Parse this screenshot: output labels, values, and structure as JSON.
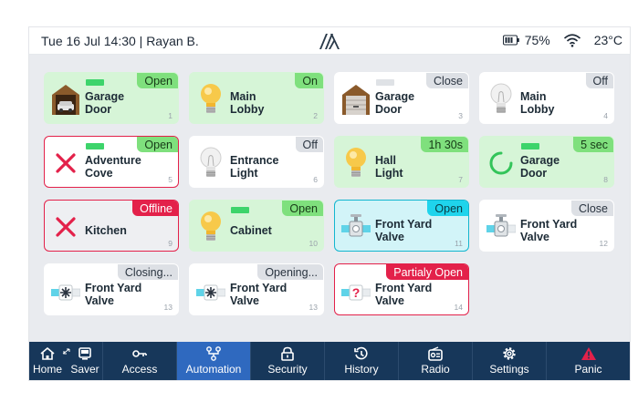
{
  "topbar": {
    "datetime_user": "Tue 16 Jul 14:30 | Rayan B.",
    "battery": "75%",
    "temperature": "23°C"
  },
  "tiles": [
    {
      "name1": "Garage",
      "name2": "Door",
      "status": "Open",
      "num": "1",
      "icon": "garage-open-icon",
      "indicator": "on"
    },
    {
      "name1": "Main",
      "name2": "Lobby",
      "status": "On",
      "num": "2",
      "icon": "bulb-on-icon",
      "indicator": ""
    },
    {
      "name1": "Garage",
      "name2": "Door",
      "status": "Close",
      "num": "3",
      "icon": "garage-closed-icon",
      "indicator": "off"
    },
    {
      "name1": "Main",
      "name2": "Lobby",
      "status": "Off",
      "num": "4",
      "icon": "bulb-off-icon",
      "indicator": ""
    },
    {
      "name1": "Adventure",
      "name2": "Cove",
      "status": "Open",
      "num": "5",
      "icon": "error-x-icon",
      "indicator": "on"
    },
    {
      "name1": "Entrance",
      "name2": "Light",
      "status": "Off",
      "num": "6",
      "icon": "bulb-off-icon",
      "indicator": ""
    },
    {
      "name1": "Hall",
      "name2": "Light",
      "status": "1h 30s",
      "num": "7",
      "icon": "bulb-on-icon",
      "indicator": ""
    },
    {
      "name1": "Garage",
      "name2": "Door",
      "status": "5 sec",
      "num": "8",
      "icon": "spinner-icon",
      "indicator": "on"
    },
    {
      "name1": "Kitchen",
      "name2": "",
      "status": "Offline",
      "num": "9",
      "icon": "error-x-icon",
      "indicator": ""
    },
    {
      "name1": "Cabinet",
      "name2": "",
      "status": "Open",
      "num": "10",
      "icon": "bulb-on-icon",
      "indicator": "on"
    },
    {
      "name1": "Front Yard",
      "name2": "Valve",
      "status": "Open",
      "num": "11",
      "icon": "valve-open-icon",
      "indicator": ""
    },
    {
      "name1": "Front Yard",
      "name2": "Valve",
      "status": "Close",
      "num": "12",
      "icon": "valve-closed-icon",
      "indicator": ""
    },
    {
      "name1": "Front Yard",
      "name2": "Valve",
      "status": "Closing...",
      "num": "13",
      "icon": "valve-moving-icon",
      "indicator": ""
    },
    {
      "name1": "Front Yard",
      "name2": "Valve",
      "status": "Opening...",
      "num": "13",
      "icon": "valve-moving-icon",
      "indicator": ""
    },
    {
      "name1": "Front Yard",
      "name2": "Valve",
      "status": "Partialy Open",
      "num": "14",
      "icon": "valve-unknown-icon",
      "indicator": ""
    }
  ],
  "nav": {
    "home": "Home",
    "saver": "Saver",
    "access": "Access",
    "automation": "Automation",
    "security": "Security",
    "history": "History",
    "radio": "Radio",
    "settings": "Settings",
    "panic": "Panic"
  },
  "colors": {
    "nav_bg": "#17375a",
    "nav_active": "#2f69bf",
    "status_green": "#7fe07d",
    "status_red": "#e3214a",
    "status_cyan": "#1fd4ec",
    "tile_green": "#d6f5d7",
    "tile_cyan": "#d2f4f8"
  }
}
